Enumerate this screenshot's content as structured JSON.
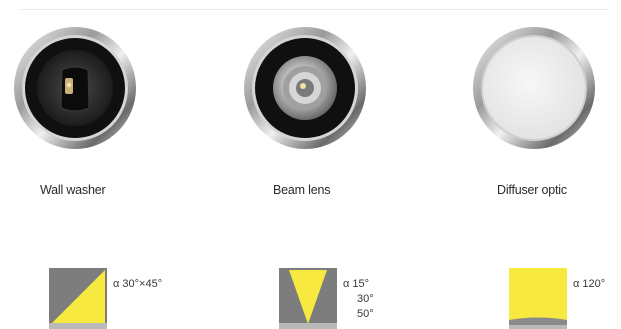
{
  "products": [
    {
      "id": "wall-washer",
      "label": "Wall washer",
      "optic": "asymmetric-insert",
      "angle_prefix": "α",
      "angles": [
        "30°×45°"
      ]
    },
    {
      "id": "beam-lens",
      "label": "Beam lens",
      "optic": "reflector-lens",
      "angle_prefix": "α",
      "angles": [
        "15°",
        "30°",
        "50°"
      ]
    },
    {
      "id": "diffuser-optic",
      "label": "Diffuser optic",
      "optic": "frosted-diffuser",
      "angle_prefix": "α",
      "angles": [
        "120°"
      ]
    }
  ],
  "colors": {
    "beam_yellow": "#f7e93f",
    "diagram_gray": "#7d7d7d",
    "bezel_light": "#e8e8e8",
    "bezel_dark": "#5a5a5a",
    "ring_black": "#111111",
    "diffuser_white": "#eeeeee"
  }
}
